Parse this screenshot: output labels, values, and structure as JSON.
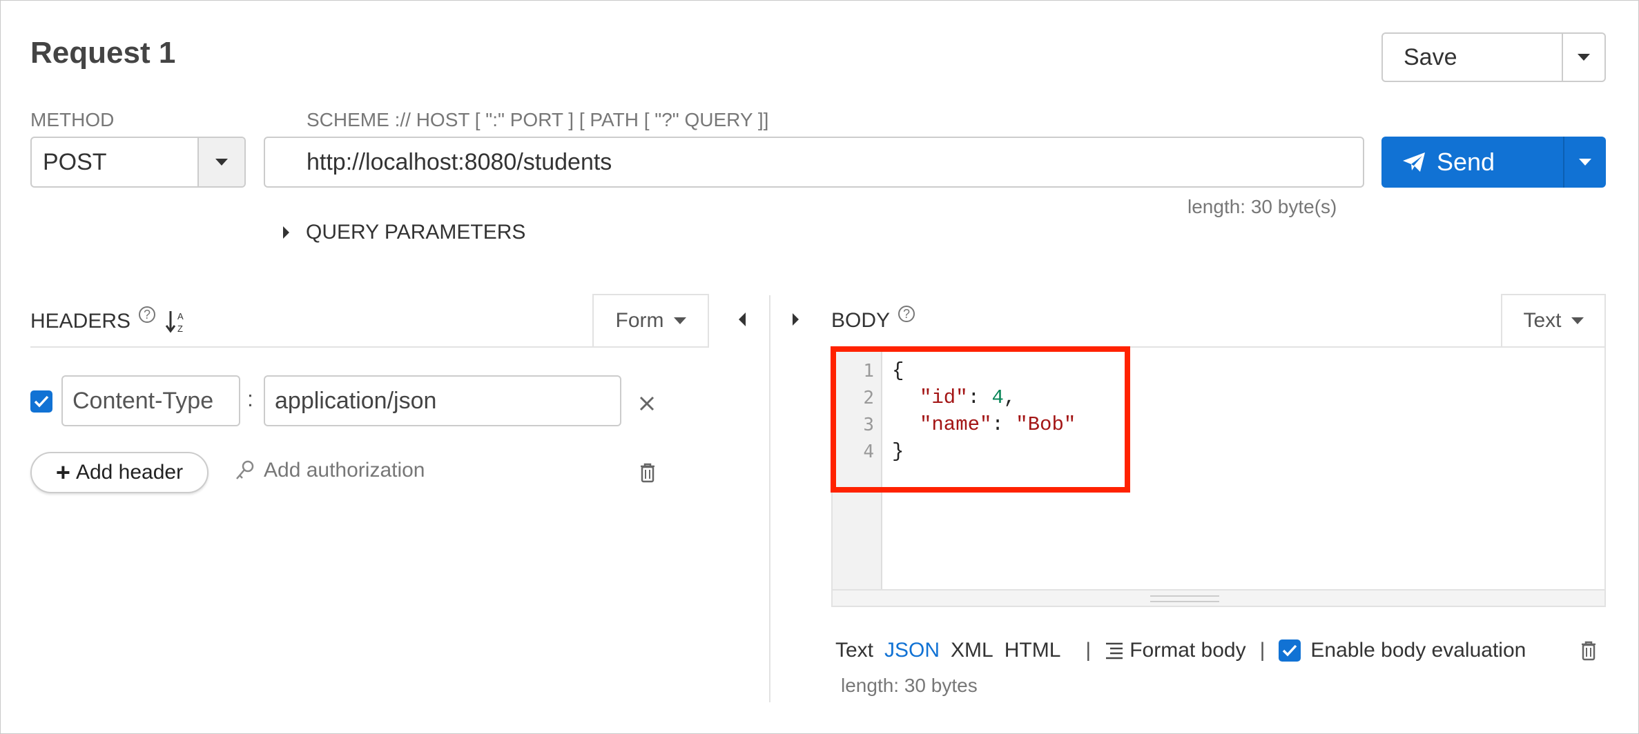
{
  "request": {
    "title": "Request 1"
  },
  "toolbar": {
    "save_label": "Save",
    "send_label": "Send"
  },
  "method": {
    "label": "METHOD",
    "value": "POST"
  },
  "url": {
    "label": "SCHEME :// HOST [ \":\" PORT ] [ PATH [ \"?\" QUERY ]]",
    "value": "http://localhost:8080/students",
    "length": "length: 30 byte(s)"
  },
  "query_params": {
    "label": "QUERY PARAMETERS"
  },
  "headers": {
    "title": "HEADERS",
    "mode": "Form",
    "items": [
      {
        "enabled": true,
        "name": "Content-Type",
        "value": "application/json"
      }
    ],
    "separator": ":",
    "add_header": "Add header",
    "add_authorization": "Add authorization"
  },
  "body": {
    "title": "BODY",
    "mode": "Text",
    "line_numbers": [
      "1",
      "2",
      "3",
      "4"
    ],
    "code": {
      "line1": "{",
      "l2_key": "\"id\"",
      "l2_colon": ": ",
      "l2_val": "4",
      "l2_comma": ",",
      "l3_key": "\"name\"",
      "l3_colon": ": ",
      "l3_val": "\"Bob\"",
      "line4": "}"
    },
    "formats": [
      "Text",
      "JSON",
      "XML",
      "HTML"
    ],
    "active_format": "JSON",
    "format_body": "Format body",
    "enable_evaluation": "Enable body evaluation",
    "enable_evaluation_checked": true,
    "length": "length: 30 bytes"
  },
  "separator_pipe": "|",
  "help_glyph": "?",
  "colors": {
    "accent": "#1172d4",
    "highlight": "#ff2200",
    "string": "#a31515",
    "number": "#098658"
  }
}
